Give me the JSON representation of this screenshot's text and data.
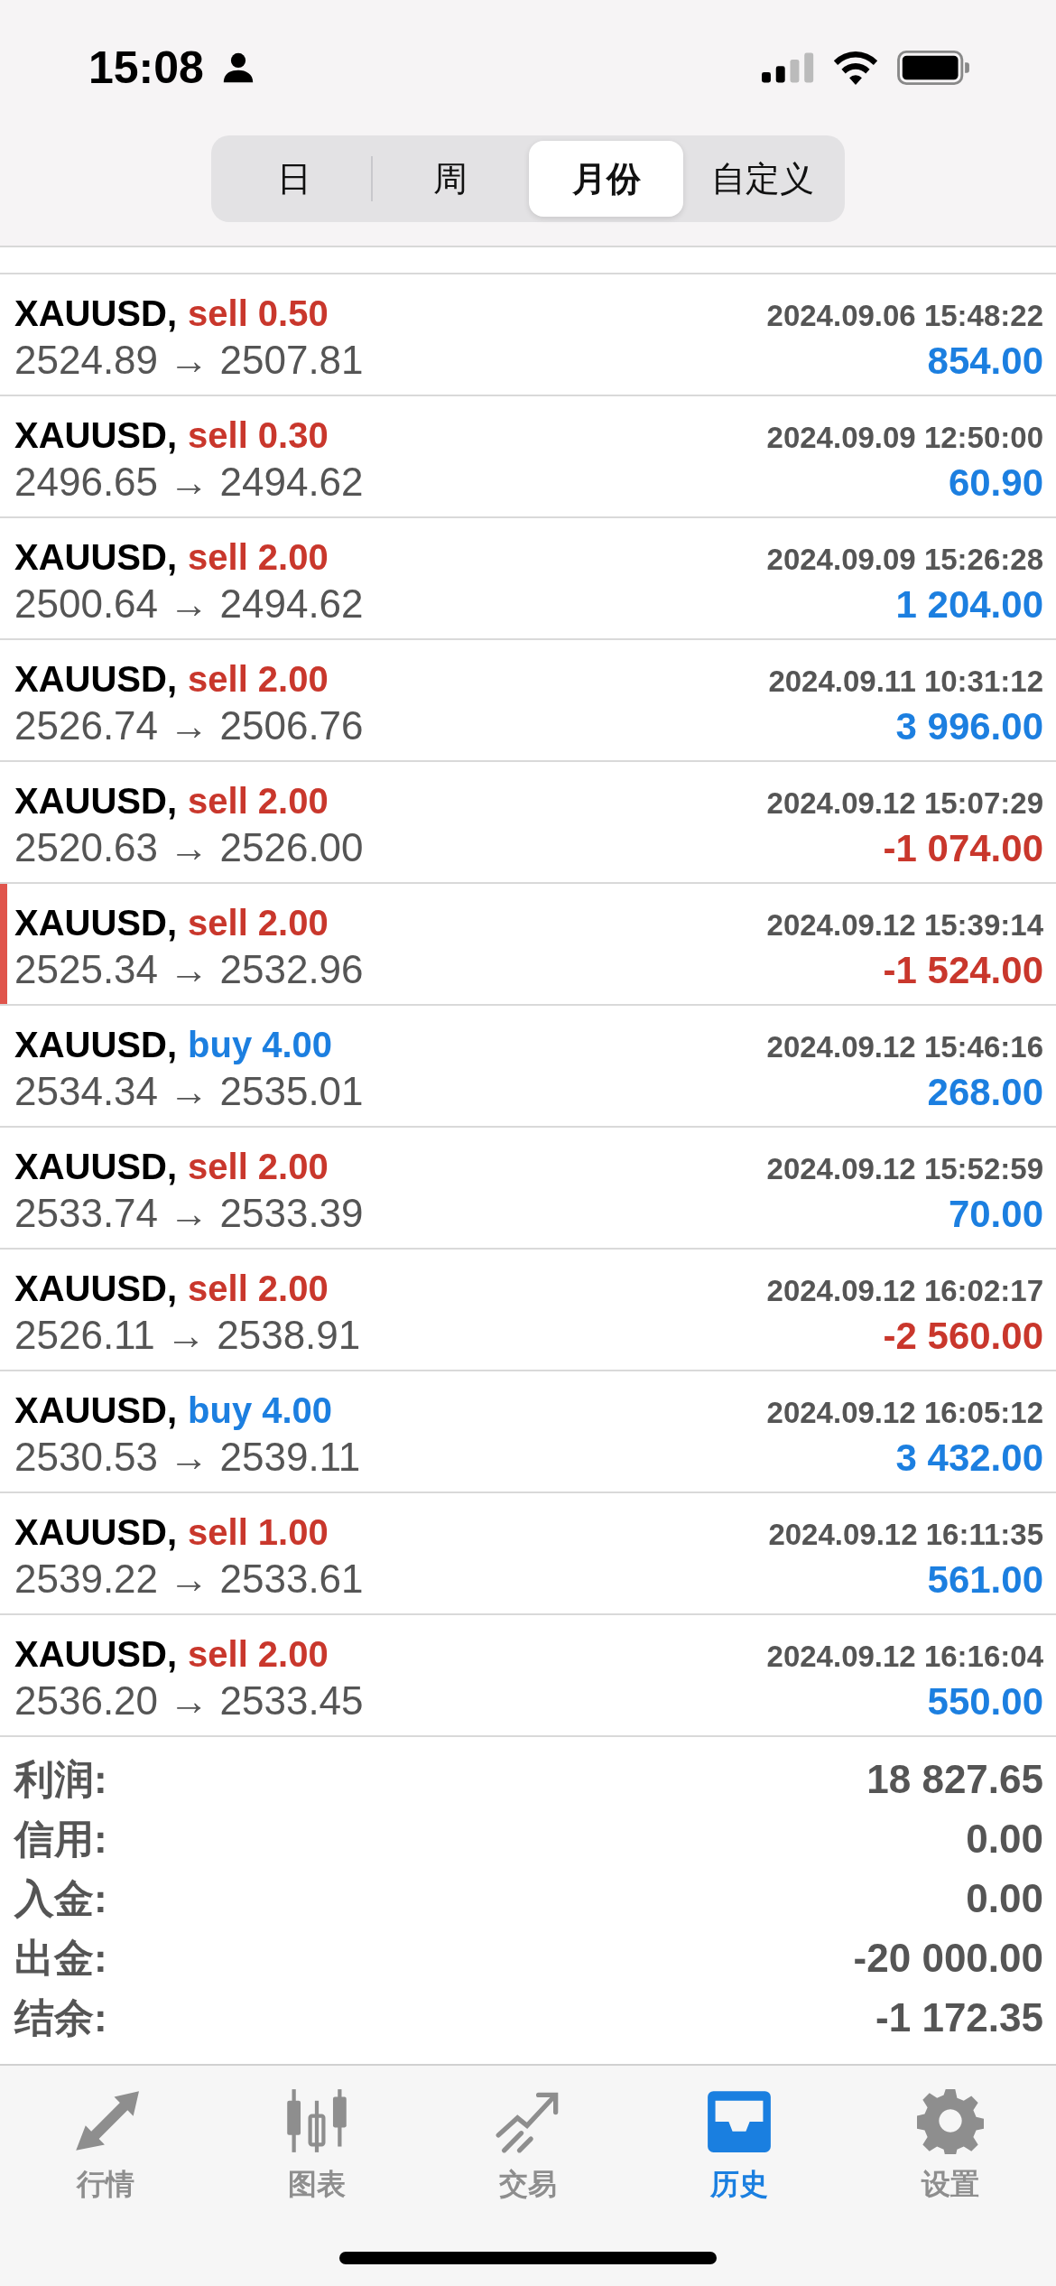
{
  "status_bar": {
    "time": "15:08"
  },
  "period_tabs": [
    {
      "label": "日",
      "selected": false
    },
    {
      "label": "周",
      "selected": false
    },
    {
      "label": "月份",
      "selected": true
    },
    {
      "label": "自定义",
      "selected": false
    }
  ],
  "deals": [
    {
      "symbol": "XAUUSD,",
      "order": {
        "text": "sell 0.50",
        "kind": "sell"
      },
      "time": "2024.09.06 15:48:22",
      "prices": "2524.89 → 2507.81",
      "profit": {
        "text": "854.00",
        "kind": "gain"
      },
      "selected": false
    },
    {
      "symbol": "XAUUSD,",
      "order": {
        "text": "sell 0.30",
        "kind": "sell"
      },
      "time": "2024.09.09 12:50:00",
      "prices": "2496.65 → 2494.62",
      "profit": {
        "text": "60.90",
        "kind": "gain"
      },
      "selected": false
    },
    {
      "symbol": "XAUUSD,",
      "order": {
        "text": "sell 2.00",
        "kind": "sell"
      },
      "time": "2024.09.09 15:26:28",
      "prices": "2500.64 → 2494.62",
      "profit": {
        "text": "1 204.00",
        "kind": "gain"
      },
      "selected": false
    },
    {
      "symbol": "XAUUSD,",
      "order": {
        "text": "sell 2.00",
        "kind": "sell"
      },
      "time": "2024.09.11 10:31:12",
      "prices": "2526.74 → 2506.76",
      "profit": {
        "text": "3 996.00",
        "kind": "gain"
      },
      "selected": false
    },
    {
      "symbol": "XAUUSD,",
      "order": {
        "text": "sell 2.00",
        "kind": "sell"
      },
      "time": "2024.09.12 15:07:29",
      "prices": "2520.63 → 2526.00",
      "profit": {
        "text": "-1 074.00",
        "kind": "loss"
      },
      "selected": false
    },
    {
      "symbol": "XAUUSD,",
      "order": {
        "text": "sell 2.00",
        "kind": "sell"
      },
      "time": "2024.09.12 15:39:14",
      "prices": "2525.34 → 2532.96",
      "profit": {
        "text": "-1 524.00",
        "kind": "loss"
      },
      "selected": true
    },
    {
      "symbol": "XAUUSD,",
      "order": {
        "text": "buy 4.00",
        "kind": "buy"
      },
      "time": "2024.09.12 15:46:16",
      "prices": "2534.34 → 2535.01",
      "profit": {
        "text": "268.00",
        "kind": "gain"
      },
      "selected": false
    },
    {
      "symbol": "XAUUSD,",
      "order": {
        "text": "sell 2.00",
        "kind": "sell"
      },
      "time": "2024.09.12 15:52:59",
      "prices": "2533.74 → 2533.39",
      "profit": {
        "text": "70.00",
        "kind": "gain"
      },
      "selected": false
    },
    {
      "symbol": "XAUUSD,",
      "order": {
        "text": "sell 2.00",
        "kind": "sell"
      },
      "time": "2024.09.12 16:02:17",
      "prices": "2526.11 → 2538.91",
      "profit": {
        "text": "-2 560.00",
        "kind": "loss"
      },
      "selected": false
    },
    {
      "symbol": "XAUUSD,",
      "order": {
        "text": "buy 4.00",
        "kind": "buy"
      },
      "time": "2024.09.12 16:05:12",
      "prices": "2530.53 → 2539.11",
      "profit": {
        "text": "3 432.00",
        "kind": "gain"
      },
      "selected": false
    },
    {
      "symbol": "XAUUSD,",
      "order": {
        "text": "sell 1.00",
        "kind": "sell"
      },
      "time": "2024.09.12 16:11:35",
      "prices": "2539.22 → 2533.61",
      "profit": {
        "text": "561.00",
        "kind": "gain"
      },
      "selected": false
    },
    {
      "symbol": "XAUUSD,",
      "order": {
        "text": "sell 2.00",
        "kind": "sell"
      },
      "time": "2024.09.12 16:16:04",
      "prices": "2536.20 → 2533.45",
      "profit": {
        "text": "550.00",
        "kind": "gain"
      },
      "selected": false
    }
  ],
  "summary": [
    {
      "label": "利润:",
      "value": "18 827.65"
    },
    {
      "label": "信用:",
      "value": "0.00"
    },
    {
      "label": "入金:",
      "value": "0.00"
    },
    {
      "label": "出金:",
      "value": "-20 000.00"
    },
    {
      "label": "结余:",
      "value": "-1 172.35"
    }
  ],
  "tab_bar": [
    {
      "label": "行情",
      "kind": "quotes",
      "selected": false
    },
    {
      "label": "图表",
      "kind": "chart",
      "selected": false
    },
    {
      "label": "交易",
      "kind": "trade",
      "selected": false
    },
    {
      "label": "历史",
      "kind": "history",
      "selected": true
    },
    {
      "label": "设置",
      "kind": "settings",
      "selected": false
    }
  ]
}
